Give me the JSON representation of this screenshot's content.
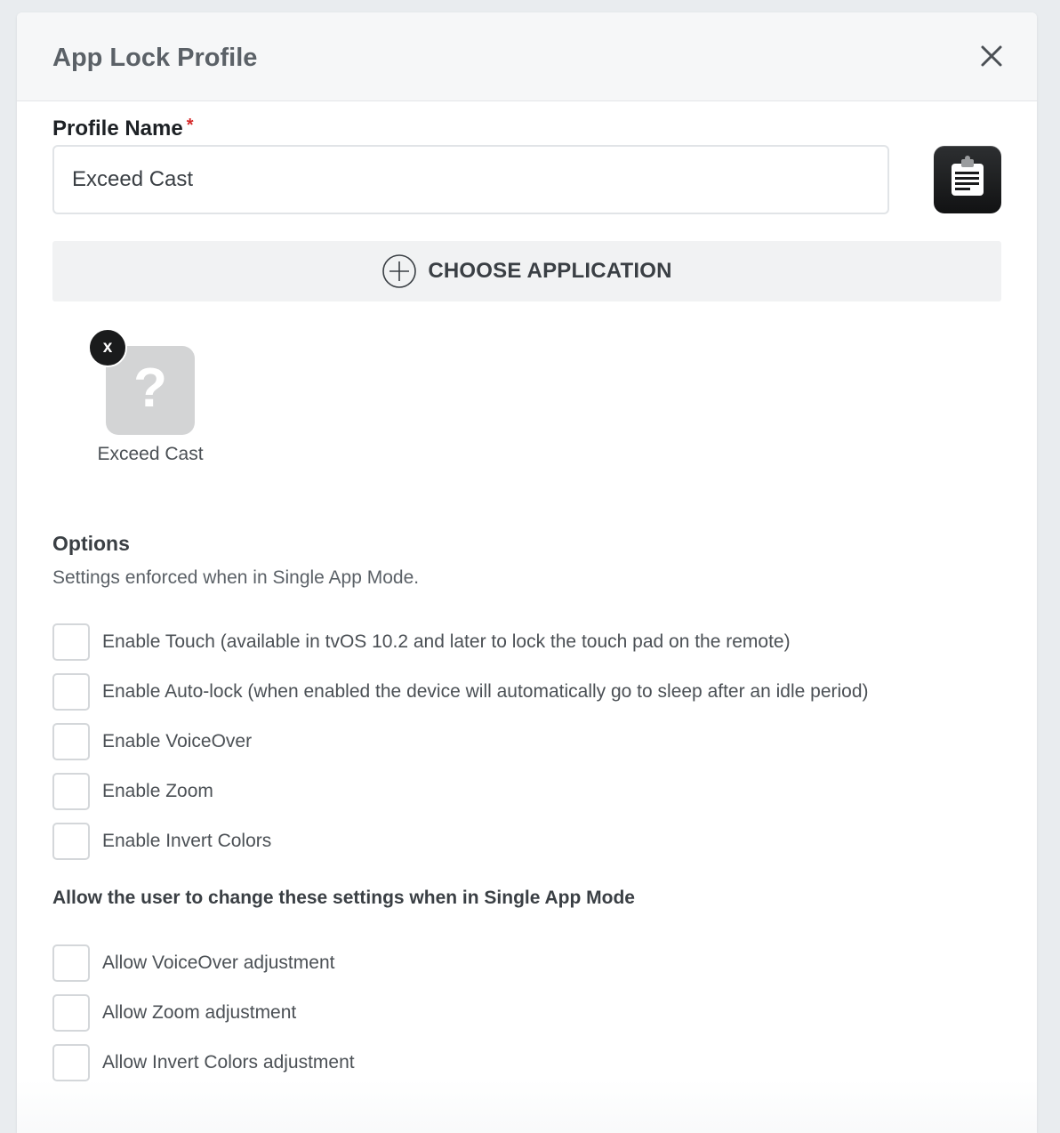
{
  "modal": {
    "title": "App Lock Profile"
  },
  "profile": {
    "label": "Profile Name",
    "required_mark": "*",
    "value": "Exceed Cast",
    "clipboard_icon": "clipboard-icon"
  },
  "choose_app": {
    "label": "CHOOSE APPLICATION",
    "icon": "plus-circle-icon"
  },
  "selected_app": {
    "name": "Exceed Cast",
    "remove_label": "x",
    "icon": "question-mark-icon"
  },
  "options": {
    "title": "Options",
    "description": "Settings enforced when in Single App Mode.",
    "items": [
      {
        "label": "Enable Touch (available in tvOS 10.2 and later to lock the touch pad on the remote)",
        "checked": false
      },
      {
        "label": "Enable Auto-lock (when enabled the device will automatically go to sleep after an idle period)",
        "checked": false
      },
      {
        "label": "Enable VoiceOver",
        "checked": false
      },
      {
        "label": "Enable Zoom",
        "checked": false
      },
      {
        "label": "Enable Invert Colors",
        "checked": false
      }
    ]
  },
  "user_settings": {
    "title": "Allow the user to change these settings when in Single App Mode",
    "items": [
      {
        "label": "Allow VoiceOver adjustment",
        "checked": false
      },
      {
        "label": "Allow Zoom adjustment",
        "checked": false
      },
      {
        "label": "Allow Invert Colors adjustment",
        "checked": false
      }
    ]
  }
}
